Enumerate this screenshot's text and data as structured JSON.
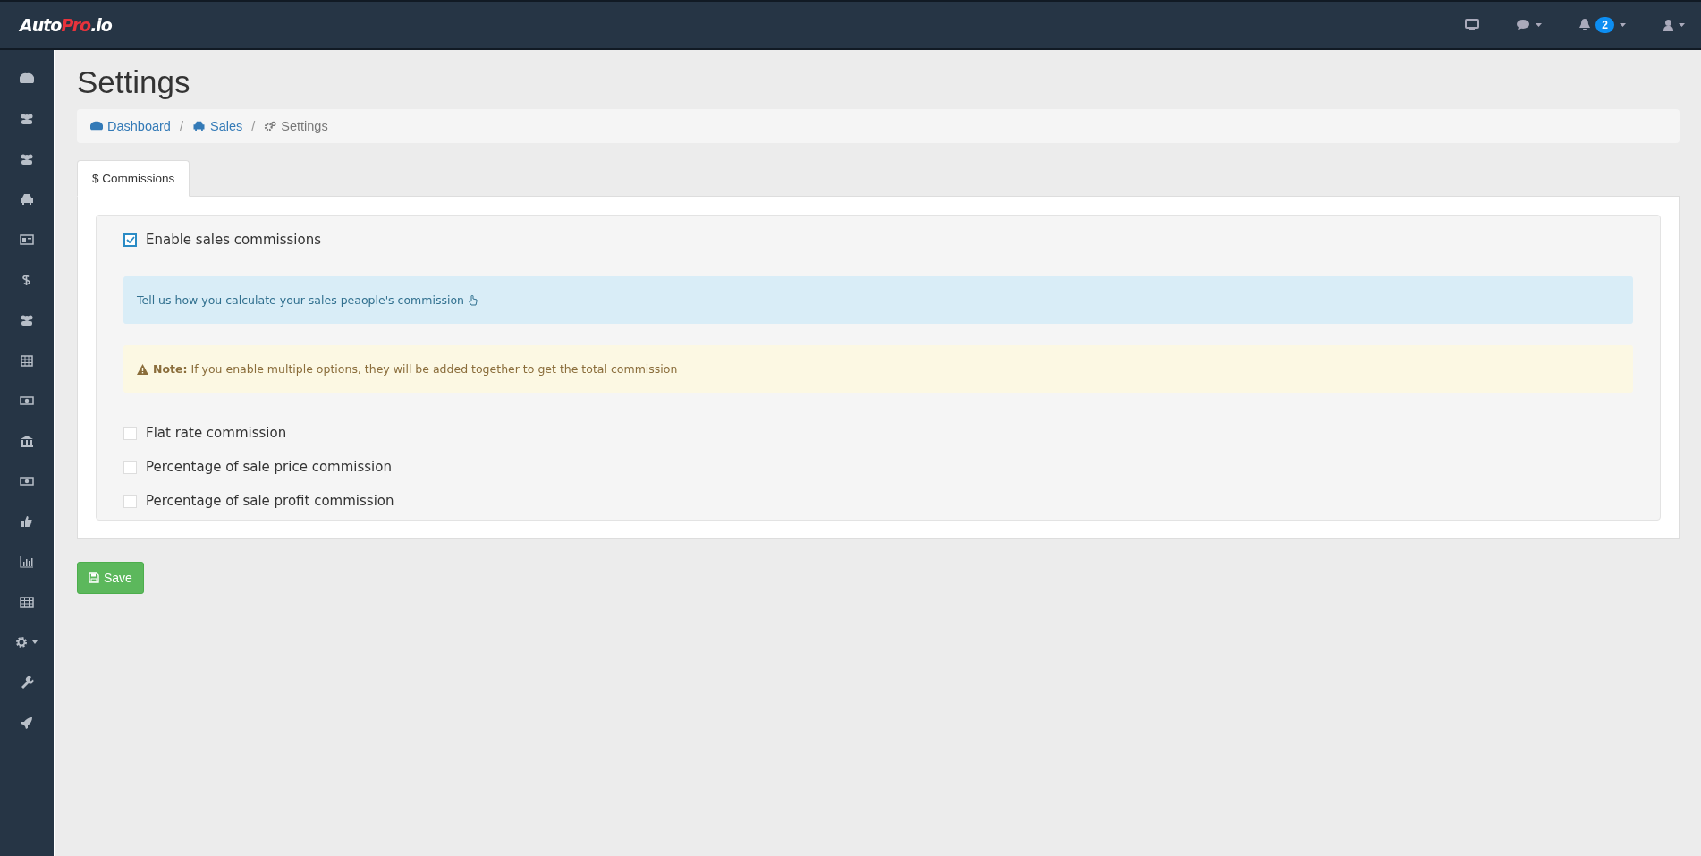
{
  "logo": [
    {
      "text": "Auto",
      "color": "#ffffff"
    },
    {
      "text": "Pro",
      "color": "#e8333c"
    },
    {
      "text": ".io",
      "color": "#ffffff"
    }
  ],
  "topbar": {
    "notification_count": "2"
  },
  "page_title": "Settings",
  "breadcrumb": [
    {
      "label": "Dashboard",
      "kind": "link"
    },
    {
      "separator": "/",
      "label": "Sales",
      "kind": "link"
    },
    {
      "separator": "/",
      "label": "Settings",
      "kind": "current"
    }
  ],
  "tabs": [
    {
      "label": "$ Commissions",
      "selected": true
    }
  ],
  "enable_option": {
    "label": "Enable sales commissions",
    "checked": true
  },
  "info_alert": "Tell us how you calculate your sales peaople's commission",
  "warning_alert": "**Note:** If you enable multiple options, they will be added together to get the total commission",
  "options": [
    {
      "label": "Flat rate commission",
      "checked": false
    },
    {
      "label": "Percentage of sale price commission",
      "checked": false
    },
    {
      "label": "Percentage of sale profit commission",
      "checked": false
    }
  ],
  "save_button": "Save"
}
